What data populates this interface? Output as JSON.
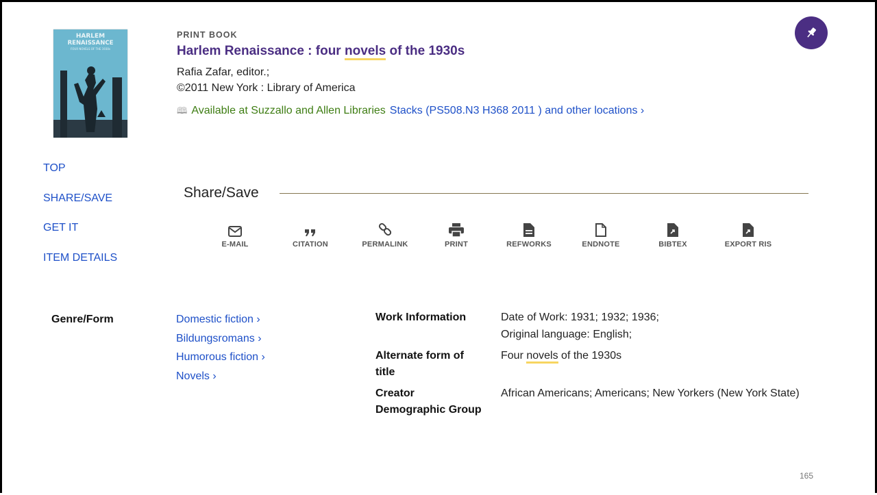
{
  "record": {
    "type_label": "PRINT BOOK",
    "title_before": "Harlem Renaissance : four ",
    "title_highlight": "novels",
    "title_after": " of the 1930s",
    "author": "Rafia Zafar, editor.;",
    "publication": "©2011 New York : Library of America",
    "availability": {
      "status": "Available at Suzzallo and Allen Libraries",
      "location": "Stacks (PS508.N3 H368 2011 ) and other locations",
      "chevron": "›"
    },
    "cover": {
      "title_line1": "HARLEM",
      "title_line2": "RENAISSANCE",
      "subtitle": "FOUR NOVELS OF THE 1930s"
    }
  },
  "sidenav": {
    "items": [
      {
        "label": "TOP"
      },
      {
        "label": "SHARE/SAVE"
      },
      {
        "label": "GET IT"
      },
      {
        "label": "ITEM DETAILS"
      }
    ]
  },
  "share": {
    "title": "Share/Save",
    "actions": [
      {
        "label": "E-MAIL",
        "icon": "envelope-icon"
      },
      {
        "label": "CITATION",
        "icon": "quote-icon"
      },
      {
        "label": "PERMALINK",
        "icon": "link-icon"
      },
      {
        "label": "PRINT",
        "icon": "printer-icon"
      },
      {
        "label": "REFWORKS",
        "icon": "document-icon"
      },
      {
        "label": "ENDNOTE",
        "icon": "file-outline-icon"
      },
      {
        "label": "BIBTEX",
        "icon": "file-export-icon"
      },
      {
        "label": "EXPORT RIS",
        "icon": "file-export-icon"
      }
    ]
  },
  "details": {
    "genre_label": "Genre/Form",
    "genres": [
      {
        "label": "Domestic fiction"
      },
      {
        "label": "Bildungsromans"
      },
      {
        "label": "Humorous fiction"
      },
      {
        "label": "Novels"
      }
    ],
    "chevron": "›",
    "work_info_label": "Work Information",
    "work_info_line1": "Date of Work: 1931; 1932; 1936;",
    "work_info_line2": "Original language: English;",
    "alt_title_label_line1": "Alternate form of",
    "alt_title_label_line2": "title",
    "alt_title_before": "Four ",
    "alt_title_highlight": "novels",
    "alt_title_after": " of the 1930s",
    "creator_label_line1": "Creator",
    "creator_label_line2": "Demographic Group",
    "creator_value": "African Americans; Americans; New Yorkers (New York State)"
  },
  "page_number": "165",
  "colors": {
    "brand_purple": "#4b2e83",
    "link_blue": "#1e50c8",
    "available_green": "#3e7d13",
    "highlight_yellow": "#f7d561",
    "rule_gold": "#857550"
  }
}
